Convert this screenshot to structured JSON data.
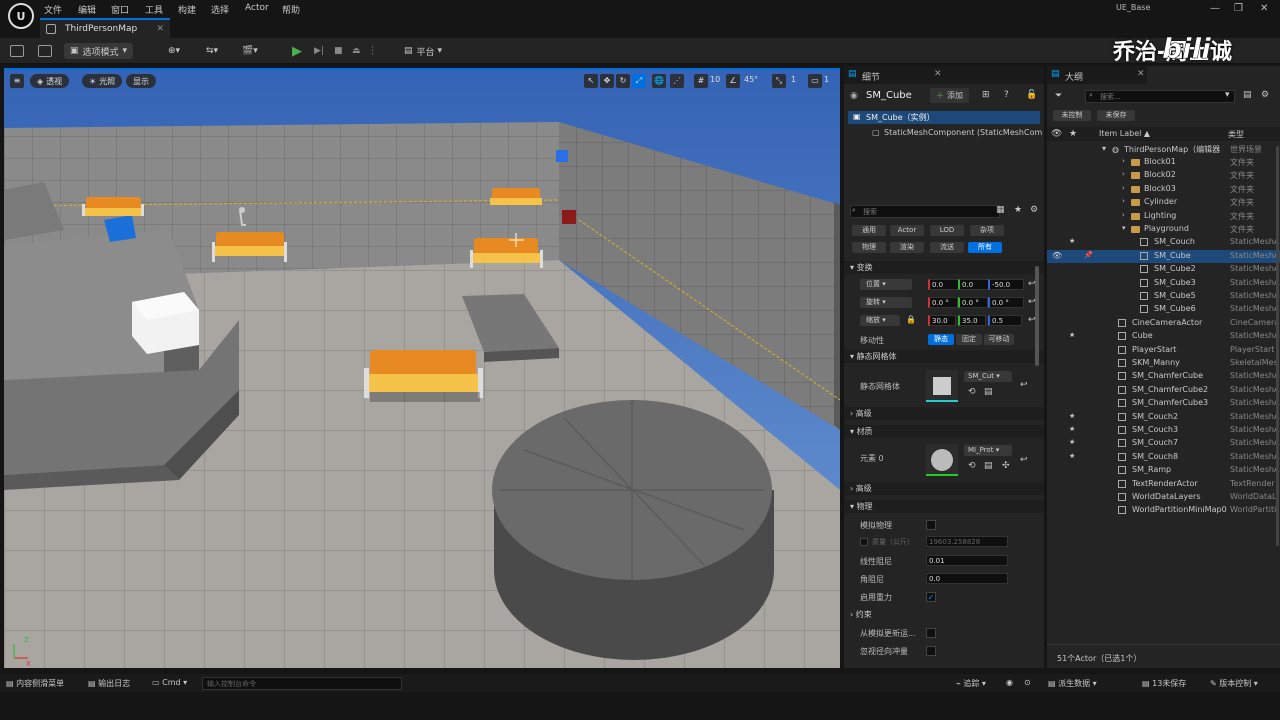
{
  "menu": [
    "文件",
    "编辑",
    "窗口",
    "工具",
    "构建",
    "选择",
    "Actor",
    "帮助"
  ],
  "window_title": "UE_Base",
  "tab": {
    "label": "ThirdPersonMap"
  },
  "watermark": {
    "text": "乔治-周士诚",
    "brand": "bilibili"
  },
  "toolbar": {
    "mode": "选项模式",
    "platform": "平台"
  },
  "viewport": {
    "buttons": [
      "透视",
      "光照",
      "显示"
    ],
    "grid": "10",
    "angle": "45°",
    "scale": "1",
    "camera": "1"
  },
  "details": {
    "tab": "细节",
    "object": "SM_Cube",
    "add": "添加",
    "instance": "SM_Cube（实例）",
    "component": "StaticMeshComponent (StaticMeshComp",
    "search_placeholder": "搜索",
    "filters": [
      "通用",
      "Actor",
      "LOD",
      "杂项",
      "物理",
      "渲染",
      "流送",
      "所有"
    ],
    "transform": {
      "section": "变换",
      "location": {
        "label": "位置",
        "x": "0.0",
        "y": "0.0",
        "z": "-50.0"
      },
      "rotation": {
        "label": "旋转",
        "x": "0.0 °",
        "y": "0.0 °",
        "z": "0.0 °"
      },
      "scale": {
        "label": "缩放",
        "x": "30.0",
        "y": "35.0",
        "z": "0.5"
      },
      "mobility": {
        "label": "移动性",
        "options": [
          "静态",
          "固定",
          "可移动"
        ]
      }
    },
    "static_mesh": {
      "section": "静态网格体",
      "label": "静态网格体",
      "value": "SM_Cut"
    },
    "advanced1": "高级",
    "materials": {
      "section": "材质",
      "label": "元素 0",
      "value": "MI_Prot"
    },
    "advanced2": "高级",
    "physics": {
      "section": "物理",
      "simulate": "模拟物理",
      "mass_label": "质量（公斤）",
      "mass": "19603.258828",
      "linear_damping": {
        "label": "线性阻尼",
        "value": "0.01"
      },
      "angular_damping": {
        "label": "角阻尼",
        "value": "0.0"
      },
      "gravity": "启用重力"
    },
    "constraints": {
      "section": "约束",
      "update": "从模拟更新运...",
      "ignore": "忽视径向冲量"
    }
  },
  "outliner": {
    "tab": "大纲",
    "search_placeholder": "搜索...",
    "unsaved1": "未控制",
    "unsaved2": "未保存",
    "col_label": "Item Label ▲",
    "col_type": "类型",
    "root": {
      "label": "ThirdPersonMap（编辑器",
      "type": "世界场景"
    },
    "rows": [
      {
        "label": "Block01",
        "type": "文件夹",
        "indent": 1,
        "kind": "folder"
      },
      {
        "label": "Block02",
        "type": "文件夹",
        "indent": 1,
        "kind": "folder"
      },
      {
        "label": "Block03",
        "type": "文件夹",
        "indent": 1,
        "kind": "folder"
      },
      {
        "label": "Cylinder",
        "type": "文件夹",
        "indent": 1,
        "kind": "folder"
      },
      {
        "label": "Lighting",
        "type": "文件夹",
        "indent": 1,
        "kind": "folder"
      },
      {
        "label": "Playground",
        "type": "文件夹",
        "indent": 1,
        "kind": "folder",
        "open": true
      },
      {
        "label": "SM_Couch",
        "type": "StaticMeshA",
        "indent": 2,
        "kind": "mesh",
        "star": true
      },
      {
        "label": "SM_Cube",
        "type": "StaticMeshA",
        "indent": 2,
        "kind": "mesh",
        "sel": true
      },
      {
        "label": "SM_Cube2",
        "type": "StaticMeshA",
        "indent": 2,
        "kind": "mesh"
      },
      {
        "label": "SM_Cube3",
        "type": "StaticMeshA",
        "indent": 2,
        "kind": "mesh"
      },
      {
        "label": "SM_Cube5",
        "type": "StaticMeshA",
        "indent": 2,
        "kind": "mesh"
      },
      {
        "label": "SM_Cube6",
        "type": "StaticMeshA",
        "indent": 2,
        "kind": "mesh"
      },
      {
        "label": "CineCameraActor",
        "type": "CineCamera",
        "indent": 0,
        "kind": "mesh"
      },
      {
        "label": "Cube",
        "type": "StaticMeshA",
        "indent": 0,
        "kind": "mesh",
        "star": true
      },
      {
        "label": "PlayerStart",
        "type": "PlayerStart",
        "indent": 0,
        "kind": "mesh"
      },
      {
        "label": "SKM_Manny",
        "type": "SkeletalMes",
        "indent": 0,
        "kind": "mesh"
      },
      {
        "label": "SM_ChamferCube",
        "type": "StaticMeshA",
        "indent": 0,
        "kind": "mesh"
      },
      {
        "label": "SM_ChamferCube2",
        "type": "StaticMeshA",
        "indent": 0,
        "kind": "mesh"
      },
      {
        "label": "SM_ChamferCube3",
        "type": "StaticMeshA",
        "indent": 0,
        "kind": "mesh"
      },
      {
        "label": "SM_Couch2",
        "type": "StaticMeshA",
        "indent": 0,
        "kind": "mesh",
        "star": true
      },
      {
        "label": "SM_Couch3",
        "type": "StaticMeshA",
        "indent": 0,
        "kind": "mesh",
        "star": true
      },
      {
        "label": "SM_Couch7",
        "type": "StaticMeshA",
        "indent": 0,
        "kind": "mesh",
        "star": true
      },
      {
        "label": "SM_Couch8",
        "type": "StaticMeshA",
        "indent": 0,
        "kind": "mesh",
        "star": true
      },
      {
        "label": "SM_Ramp",
        "type": "StaticMeshA",
        "indent": 0,
        "kind": "mesh"
      },
      {
        "label": "TextRenderActor",
        "type": "TextRender",
        "indent": 0,
        "kind": "mesh"
      },
      {
        "label": "WorldDataLayers",
        "type": "WorldDataL",
        "indent": 0,
        "kind": "mesh"
      },
      {
        "label": "WorldPartitionMiniMap0",
        "type": "WorldPartiti",
        "indent": 0,
        "kind": "mesh"
      }
    ],
    "footer": "51个Actor（已选1个）"
  },
  "statusbar": {
    "content_drawer": "内容侧滑菜单",
    "output_log": "输出日志",
    "cmd": "Cmd",
    "cmd_placeholder": "输入控制台命令",
    "trace": "追踪",
    "derived": "派生数据",
    "unsaved": "13未保存",
    "source_control": "版本控制"
  },
  "colors": {
    "accent": "#0070e0",
    "panel": "#242424",
    "dark": "#151515",
    "sky": "#3d6fbf",
    "couch": "#e88a22"
  }
}
